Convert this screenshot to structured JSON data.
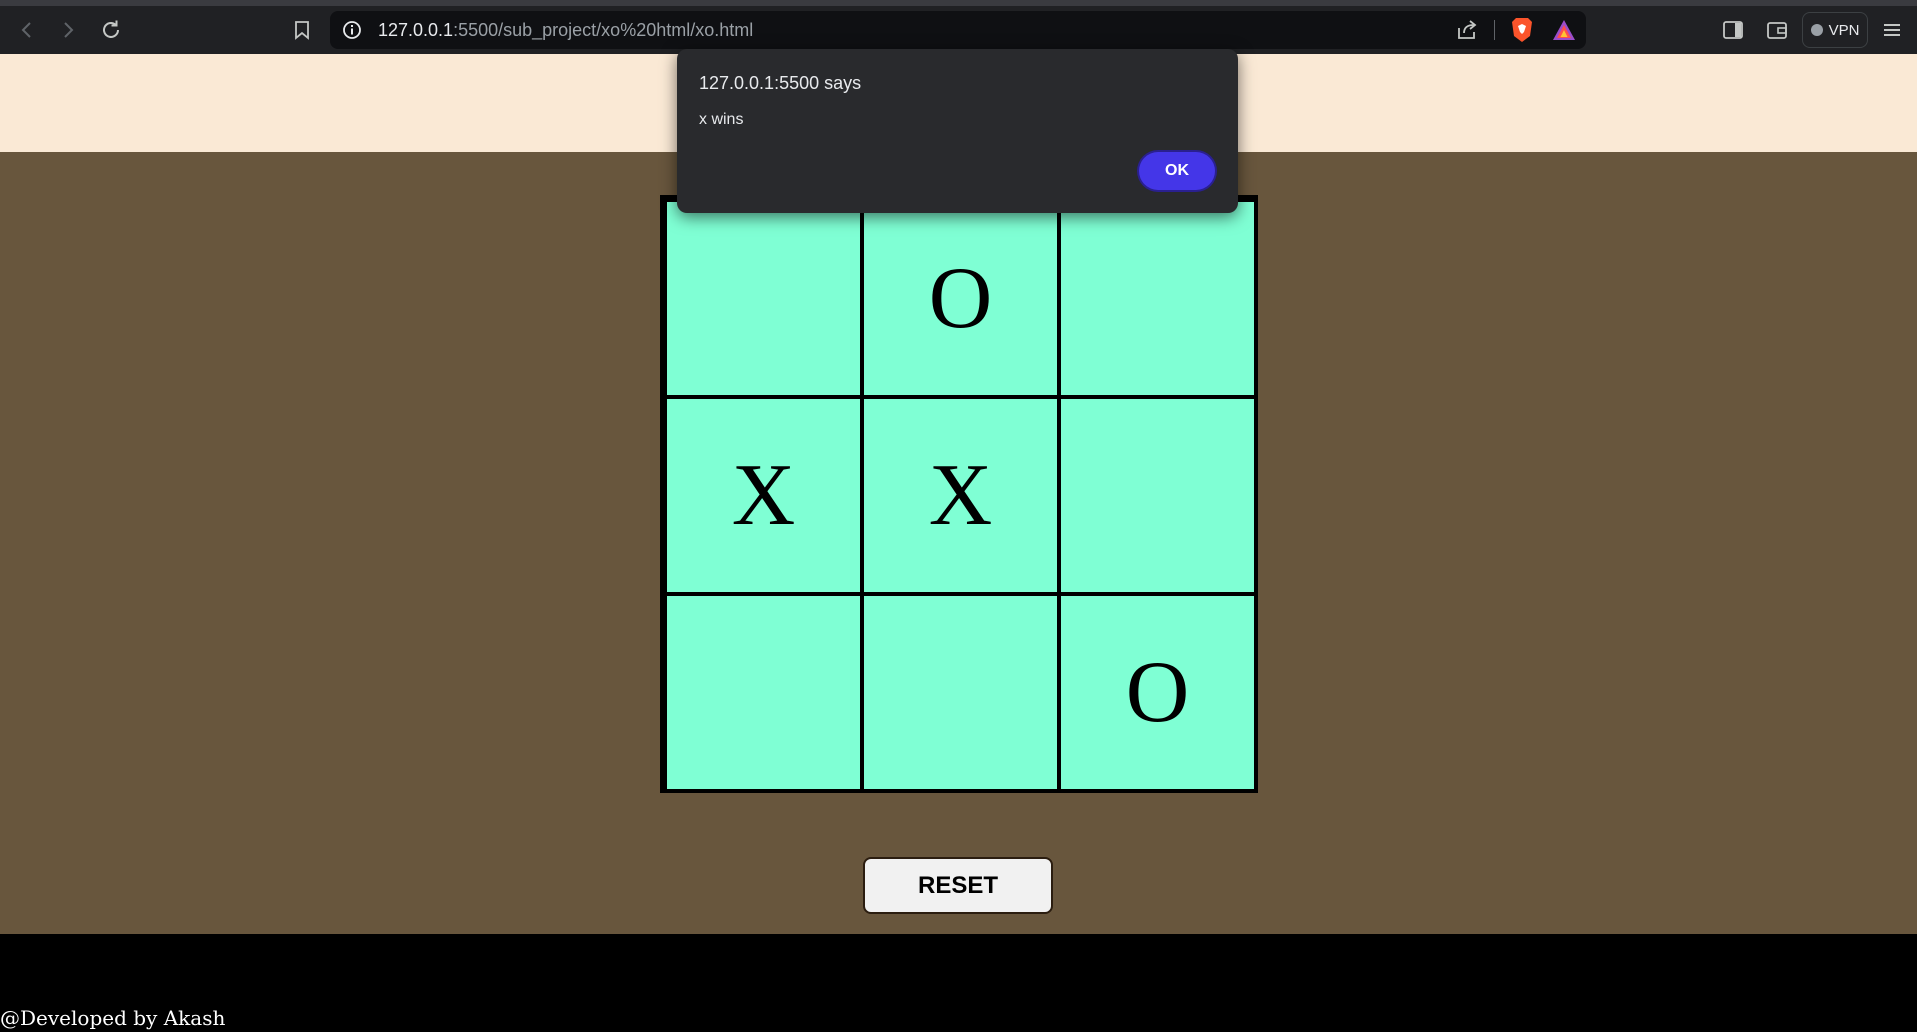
{
  "browser": {
    "url_host": "127.0.0.1",
    "url_rest": ":5500/sub_project/xo%20html/xo.html",
    "vpn_label": "VPN"
  },
  "game": {
    "cells": [
      "",
      "O",
      "",
      "X",
      "X",
      "",
      "",
      "",
      "O"
    ],
    "reset_label": "RESET"
  },
  "footer": {
    "credit": "@Developed by Akash"
  },
  "alert": {
    "title": "127.0.0.1:5500 says",
    "message": "x wins",
    "ok_label": "OK",
    "ok_color": "#4436e8"
  },
  "colors": {
    "header_bg": "#fae9d5",
    "main_bg": "#68563d",
    "cell_bg": "#7fffd4",
    "footer_bg": "#000000"
  }
}
